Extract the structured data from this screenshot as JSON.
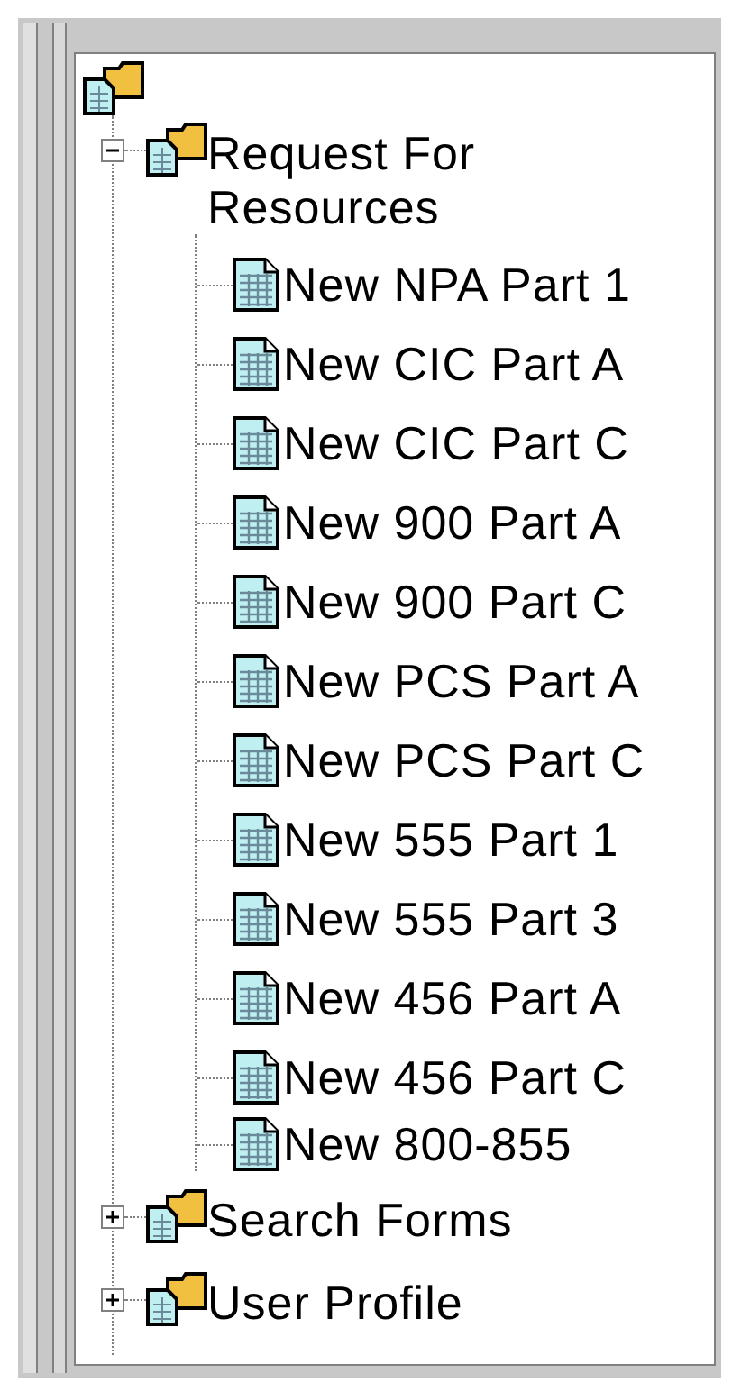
{
  "tree": {
    "children": [
      {
        "label": "Request For Resources",
        "expanded": true,
        "children": [
          {
            "label": "New NPA Part 1"
          },
          {
            "label": "New CIC Part A"
          },
          {
            "label": "New CIC Part C"
          },
          {
            "label": "New 900 Part A"
          },
          {
            "label": "New 900 Part C"
          },
          {
            "label": "New PCS Part A"
          },
          {
            "label": "New PCS Part C"
          },
          {
            "label": "New 555 Part 1"
          },
          {
            "label": "New 555 Part 3"
          },
          {
            "label": "New 456 Part A"
          },
          {
            "label": "New 456 Part C"
          },
          {
            "label": "New 800-855"
          }
        ]
      },
      {
        "label": "Search Forms",
        "expanded": false
      },
      {
        "label": "User Profile",
        "expanded": false
      }
    ]
  }
}
